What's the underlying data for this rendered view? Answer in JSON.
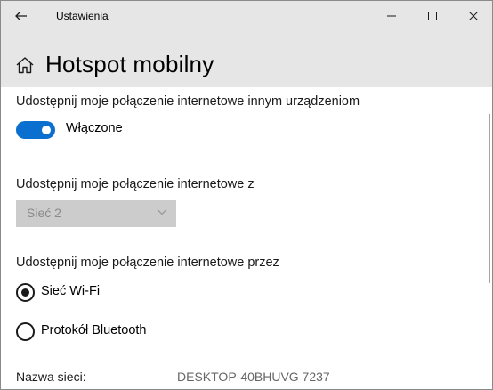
{
  "titlebar": {
    "app_title": "Ustawienia"
  },
  "header": {
    "page_title": "Hotspot mobilny"
  },
  "sharing": {
    "toggle_section_label": "Udostępnij moje połączenie internetowe innym urządzeniom",
    "toggle_state": "Włączone",
    "toggle_on": true,
    "from_label": "Udostępnij moje połączenie internetowe z",
    "from_value": "Sieć  2",
    "via_label": "Udostępnij moje połączenie internetowe przez",
    "via_options": [
      {
        "label": "Sieć Wi-Fi",
        "selected": true
      },
      {
        "label": "Protokół Bluetooth",
        "selected": false
      }
    ],
    "network_name_label": "Nazwa sieci:",
    "network_name_value": "DESKTOP-40BHUVG 7237"
  },
  "colors": {
    "accent": "#0a6fce",
    "chrome": "#e6e6e6",
    "disabled_field": "#cccccc"
  },
  "icons": {
    "back": "back-arrow-icon",
    "home": "home-icon",
    "minimize": "minimize-icon",
    "maximize": "maximize-icon",
    "close": "close-icon",
    "dropdown": "chevron-down-icon"
  }
}
